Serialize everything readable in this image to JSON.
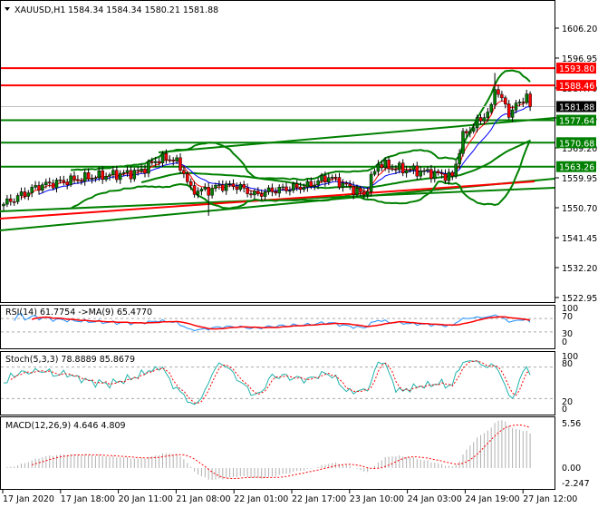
{
  "header": {
    "symbol": "XAUUSD,H1",
    "ohlc": "1584.34 1584.34 1580.21 1581.88"
  },
  "colors": {
    "up": "#008000",
    "down": "#ff0000",
    "red_level": "#ff0000",
    "green_level": "#008000",
    "current": "#000000"
  },
  "price_axis": [
    "1606.20",
    "1596.95",
    "1587.70",
    "1578.45",
    "1569.20",
    "1559.95",
    "1550.70",
    "1541.45",
    "1532.20",
    "1522.95"
  ],
  "levels": [
    {
      "label": "1593.80",
      "value": 1593.8,
      "color": "#ff0000"
    },
    {
      "label": "1588.46",
      "value": 1588.46,
      "color": "#ff0000"
    },
    {
      "label": "1581.88",
      "value": 1581.88,
      "color": "#000000"
    },
    {
      "label": "1577.64",
      "value": 1577.64,
      "color": "#008000"
    },
    {
      "label": "1570.68",
      "value": 1570.68,
      "color": "#008000"
    },
    {
      "label": "1563.26",
      "value": 1563.26,
      "color": "#008000"
    }
  ],
  "rsi": {
    "title": "RSI(14) 61.7754  ->MA(9) 65.4770",
    "axis": [
      "100",
      "70",
      "30",
      "0"
    ]
  },
  "stoch": {
    "title": "Stoch(5,3,3) 78.8889 85.8679",
    "axis": [
      "100",
      "80",
      "20",
      "0"
    ]
  },
  "macd": {
    "title": "MACD(12,26,9) 4.646 4.809",
    "axis": [
      "5.56",
      "0.00",
      "-2.247"
    ]
  },
  "time_axis": [
    "17 Jan 2020",
    "17 Jan 18:00",
    "20 Jan 11:00",
    "21 Jan 08:00",
    "22 Jan 01:00",
    "22 Jan 17:00",
    "23 Jan 10:00",
    "24 Jan 03:00",
    "24 Jan 19:00",
    "27 Jan 12:00"
  ],
  "chart_data": {
    "type": "candlestick",
    "bars": 150,
    "close_keypoints": [
      [
        0,
        1551.6
      ],
      [
        10,
        1557.3
      ],
      [
        17,
        1558.7
      ],
      [
        25,
        1560.1
      ],
      [
        38,
        1561.5
      ],
      [
        44,
        1565.7
      ],
      [
        48,
        1565.7
      ],
      [
        51,
        1561.5
      ],
      [
        53,
        1555.9
      ],
      [
        58,
        1555.9
      ],
      [
        61,
        1557.3
      ],
      [
        66,
        1557.3
      ],
      [
        71,
        1554.5
      ],
      [
        76,
        1555.9
      ],
      [
        86,
        1557.3
      ],
      [
        92,
        1560.1
      ],
      [
        97,
        1557.3
      ],
      [
        102,
        1554.5
      ],
      [
        106,
        1564.3
      ],
      [
        110,
        1562.9
      ],
      [
        120,
        1561.5
      ],
      [
        127,
        1560.1
      ],
      [
        130,
        1572.7
      ],
      [
        138,
        1581.2
      ],
      [
        139,
        1588.2
      ],
      [
        143,
        1579.8
      ],
      [
        148,
        1585.4
      ],
      [
        150,
        1581.88
      ]
    ],
    "ylim": [
      1520,
      1613
    ]
  }
}
